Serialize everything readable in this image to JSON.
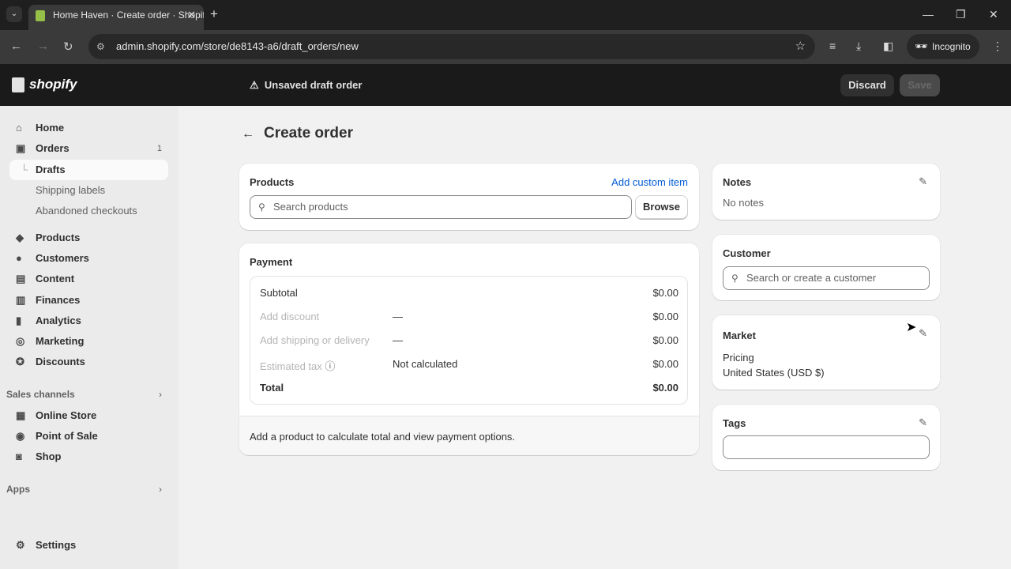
{
  "browser": {
    "tab_title": "Home Haven · Create order · Shopify",
    "url": "admin.shopify.com/store/de8143-a6/draft_orders/new",
    "incognito_label": "Incognito"
  },
  "header": {
    "logo": "shopify",
    "status": "Unsaved draft order",
    "discard": "Discard",
    "save": "Save"
  },
  "sidebar": {
    "items": [
      {
        "label": "Home",
        "icon": "home-icon"
      },
      {
        "label": "Orders",
        "icon": "inbox-icon",
        "badge": "1"
      },
      {
        "label": "Drafts"
      },
      {
        "label": "Shipping labels"
      },
      {
        "label": "Abandoned checkouts"
      },
      {
        "label": "Products",
        "icon": "tag-icon"
      },
      {
        "label": "Customers",
        "icon": "person-icon"
      },
      {
        "label": "Content",
        "icon": "content-icon"
      },
      {
        "label": "Finances",
        "icon": "bank-icon"
      },
      {
        "label": "Analytics",
        "icon": "chart-icon"
      },
      {
        "label": "Marketing",
        "icon": "target-icon"
      },
      {
        "label": "Discounts",
        "icon": "discount-icon"
      }
    ],
    "sales_channels_label": "Sales channels",
    "channels": [
      {
        "label": "Online Store"
      },
      {
        "label": "Point of Sale"
      },
      {
        "label": "Shop"
      }
    ],
    "apps_label": "Apps",
    "settings": "Settings"
  },
  "main": {
    "title": "Create order",
    "products": {
      "heading": "Products",
      "add_custom": "Add custom item",
      "search_placeholder": "Search products",
      "browse": "Browse"
    },
    "payment": {
      "heading": "Payment",
      "rows": [
        {
          "label": "Subtotal",
          "middle": "",
          "amount": "$0.00"
        },
        {
          "label": "Add discount",
          "middle": "—",
          "amount": "$0.00"
        },
        {
          "label": "Add shipping or delivery",
          "middle": "—",
          "amount": "$0.00"
        },
        {
          "label": "Estimated tax",
          "middle": "Not calculated",
          "amount": "$0.00"
        },
        {
          "label": "Total",
          "middle": "",
          "amount": "$0.00"
        }
      ],
      "footer": "Add a product to calculate total and view payment options."
    },
    "notes": {
      "heading": "Notes",
      "text": "No notes"
    },
    "customer": {
      "heading": "Customer",
      "placeholder": "Search or create a customer"
    },
    "market": {
      "heading": "Market",
      "pricing_label": "Pricing",
      "pricing_value": "United States (USD $)"
    },
    "tags": {
      "heading": "Tags",
      "value": ""
    }
  }
}
